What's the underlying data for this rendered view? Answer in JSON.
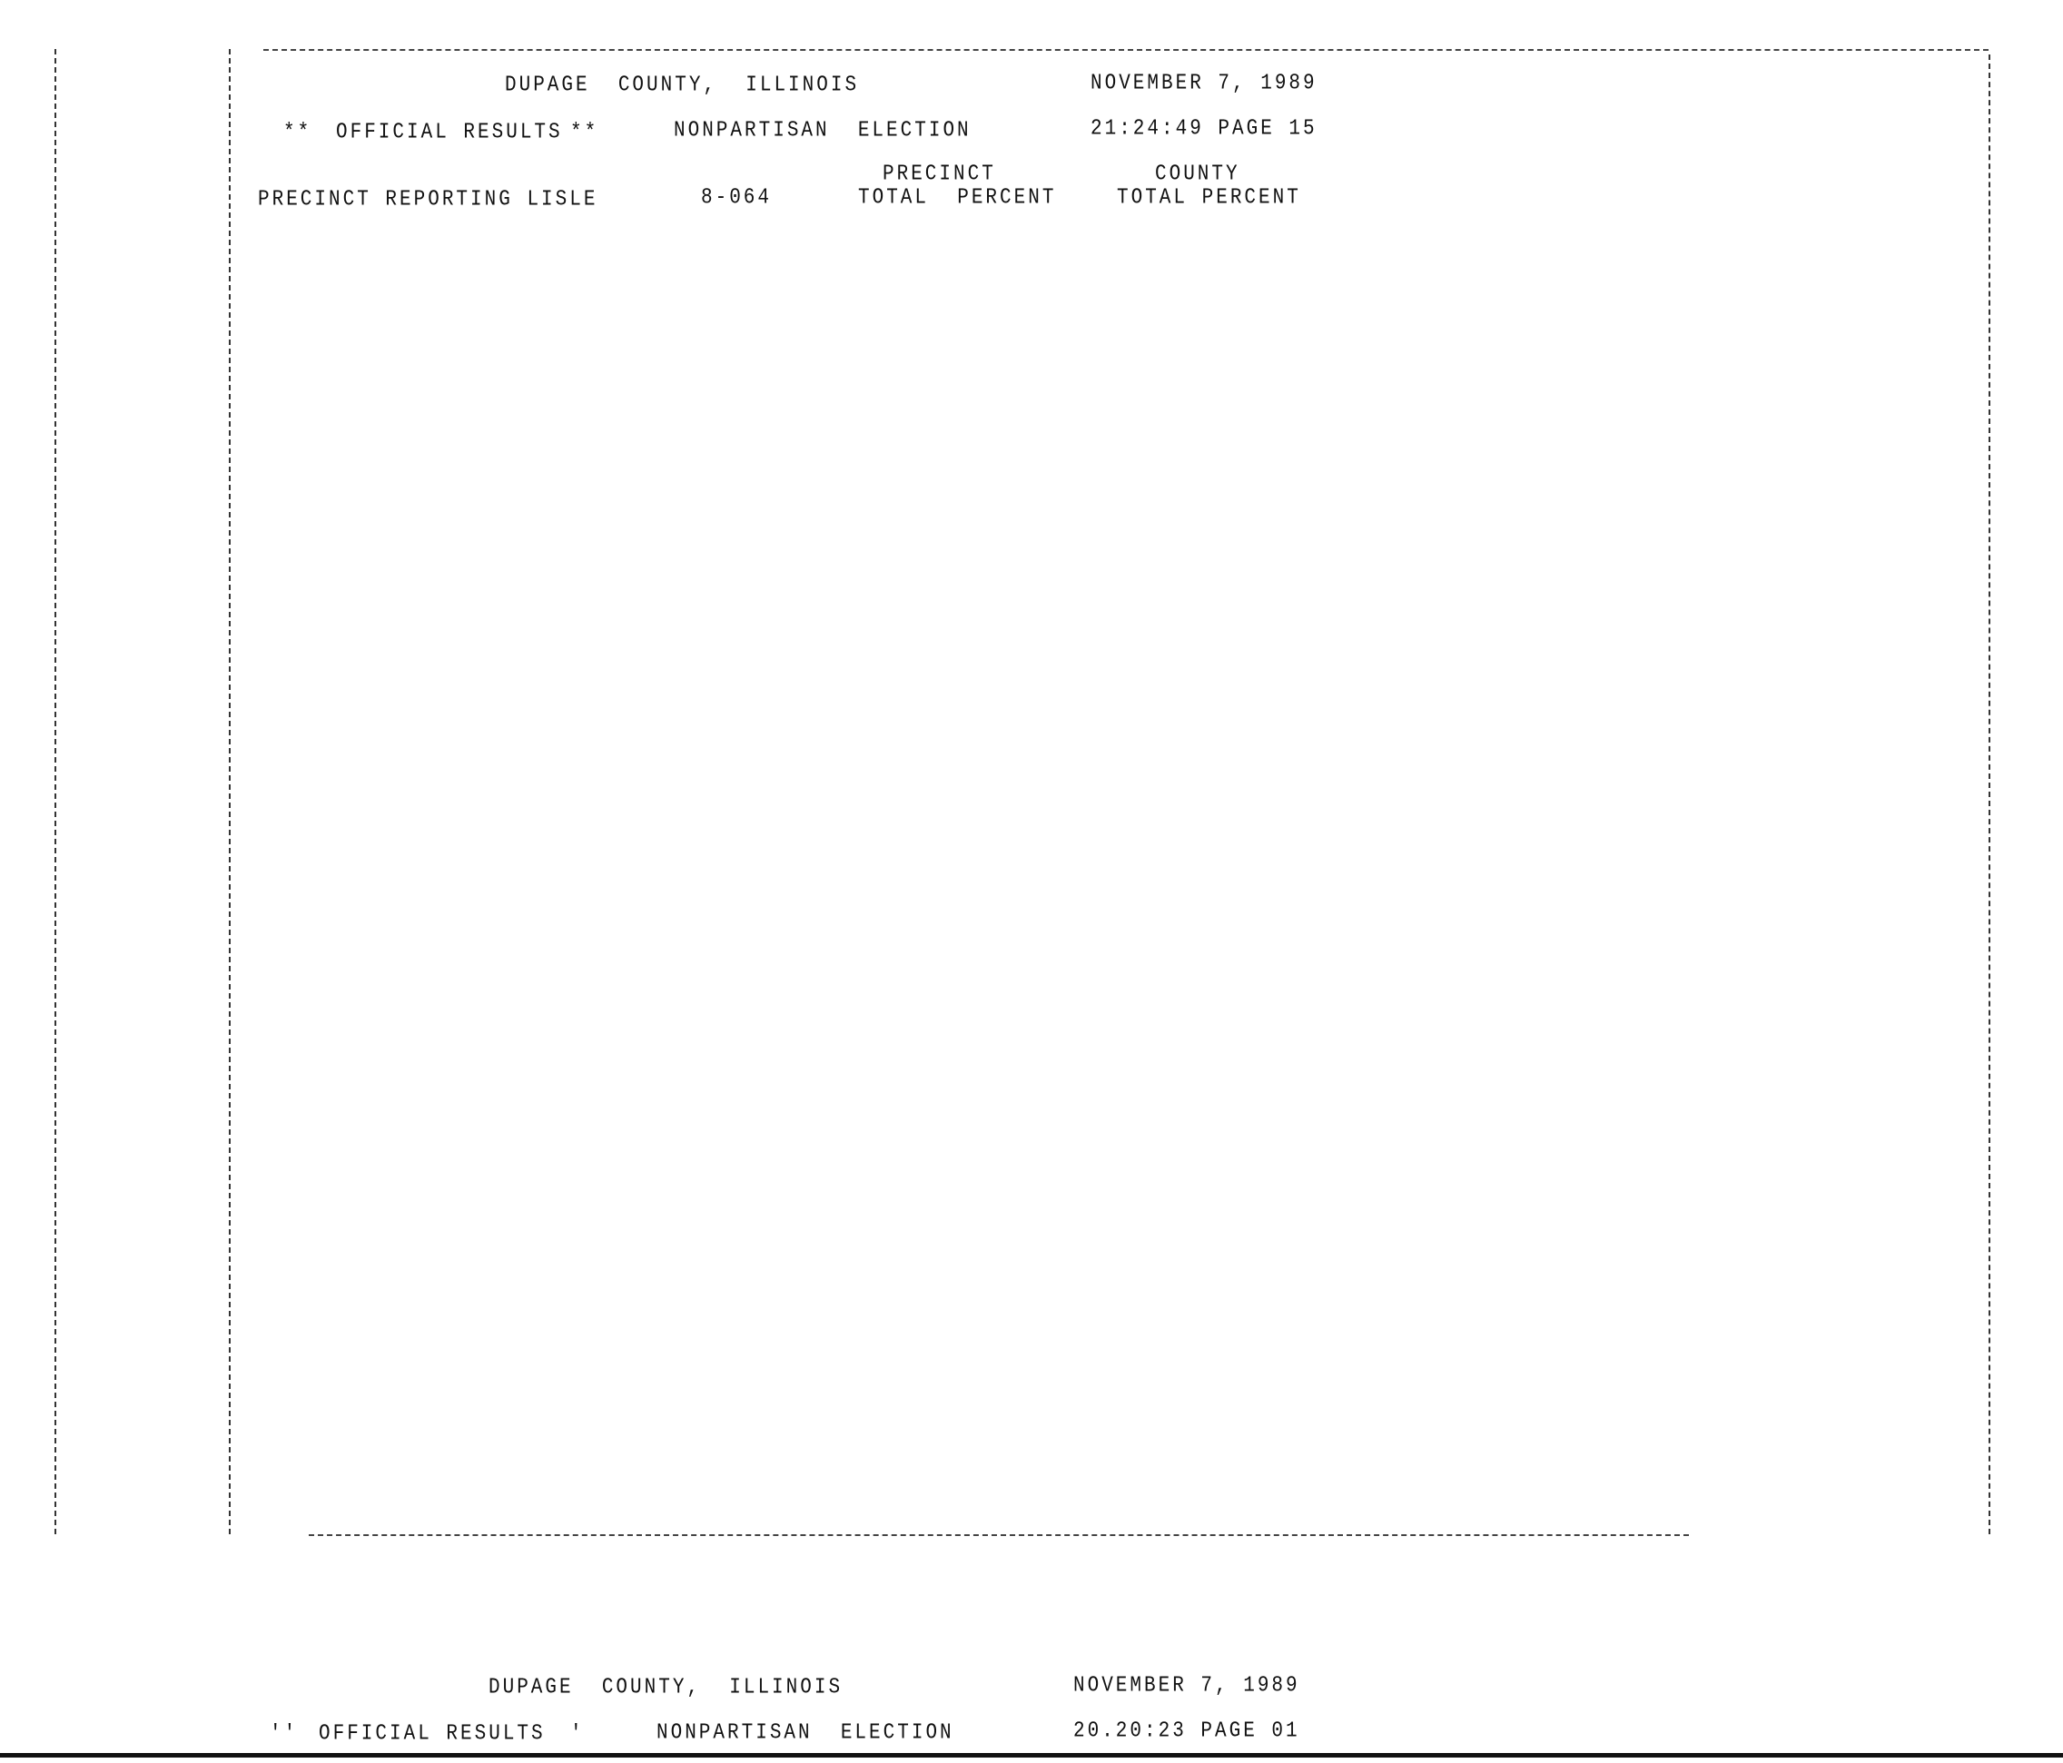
{
  "page1": {
    "county": "DUPAGE  COUNTY,  ILLINOIS",
    "date": "NOVEMBER 7, 1989",
    "official_marks_left": "**",
    "official": "OFFICIAL RESULTS",
    "official_marks_right": "**",
    "election": "NONPARTISAN  ELECTION",
    "time_page": "21:24:49 PAGE 15",
    "col_precinct": "PRECINCT",
    "col_county": "COUNTY",
    "row_label": "PRECINCT REPORTING LISLE",
    "precinct_id": "8-064",
    "precinct_sub": "TOTAL  PERCENT",
    "county_sub": "TOTAL PERCENT"
  },
  "page2": {
    "county": "DUPAGE  COUNTY,  ILLINOIS",
    "date": "NOVEMBER 7, 1989",
    "official_marks_left": "''",
    "official": "OFFICIAL RESULTS",
    "official_marks_right": "'",
    "election": "NONPARTISAN  ELECTION",
    "time_page": "20.20:23 PAGE 01"
  }
}
